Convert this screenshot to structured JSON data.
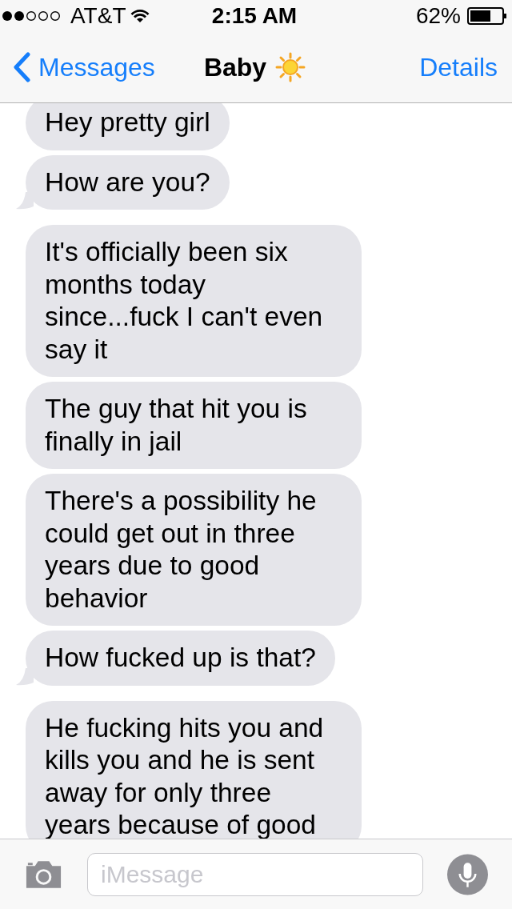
{
  "status_bar": {
    "carrier": "AT&T",
    "time": "2:15 AM",
    "battery": "62%"
  },
  "nav_bar": {
    "back": "Messages",
    "title": "Baby",
    "details": "Details"
  },
  "messages": [
    {
      "text": "Hey pretty girl",
      "tail": false
    },
    {
      "text": "How are you?",
      "tail": true
    },
    {
      "text": "It's officially been six months today since...fuck I can't even say it",
      "tail": false
    },
    {
      "text": "The guy that hit you is finally in jail",
      "tail": false
    },
    {
      "text": "There's a possibility he could get out in three years due to good behavior",
      "tail": false
    },
    {
      "text": "How fucked up is that?",
      "tail": true
    },
    {
      "text": "He fucking hits you and kills you and he is sent away for only three years because of good",
      "tail": false
    }
  ],
  "input_bar": {
    "placeholder": "iMessage"
  }
}
